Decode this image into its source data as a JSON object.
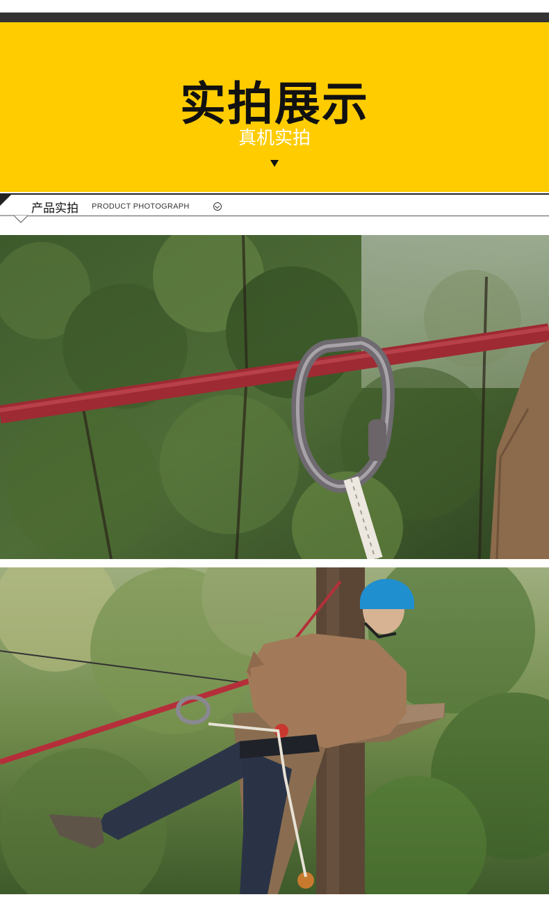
{
  "banner": {
    "title": "实拍展示",
    "subtitle": "真机实拍",
    "background_color": "#ffcc00"
  },
  "section": {
    "title": "产品实拍",
    "english": "PRODUCT PHOTOGRAPH",
    "icon": "chevron-down-circle-icon"
  },
  "photos": [
    {
      "subject": "carabiner-on-rope-photo"
    },
    {
      "subject": "zipline-rider-photo"
    }
  ]
}
